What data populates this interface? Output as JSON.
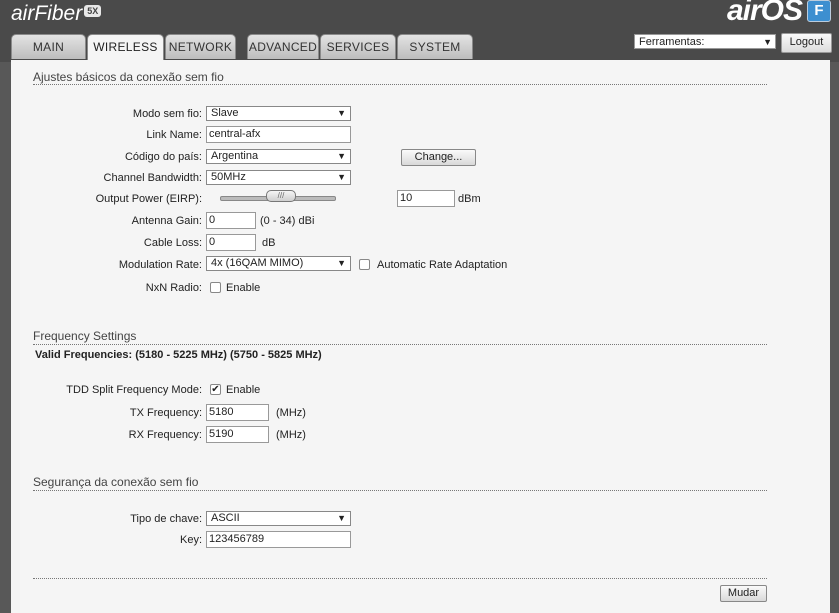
{
  "header": {
    "brand": "airFiber",
    "brand_badge": "5X",
    "product": "airOS",
    "product_badge": "F",
    "tools_select": "Ferramentas:",
    "logout_label": "Logout"
  },
  "tabs": [
    {
      "label": "MAIN",
      "active": false
    },
    {
      "label": "WIRELESS",
      "active": true
    },
    {
      "label": "NETWORK",
      "active": false
    },
    {
      "label": "ADVANCED",
      "active": false
    },
    {
      "label": "SERVICES",
      "active": false
    },
    {
      "label": "SYSTEM",
      "active": false
    }
  ],
  "basic": {
    "title": "Ajustes básicos da conexão sem fio",
    "wireless_mode_label": "Modo sem fio:",
    "wireless_mode_value": "Slave",
    "link_name_label": "Link Name:",
    "link_name_value": "central-afx",
    "country_label": "Código do país:",
    "country_value": "Argentina",
    "change_button": "Change...",
    "bandwidth_label": "Channel Bandwidth:",
    "bandwidth_value": "50MHz",
    "power_label": "Output Power (EIRP):",
    "power_value": "10",
    "power_unit": "dBm",
    "antenna_gain_label": "Antenna Gain:",
    "antenna_gain_value": "0",
    "antenna_gain_range": "(0 - 34) dBi",
    "cable_loss_label": "Cable Loss:",
    "cable_loss_value": "0",
    "cable_loss_unit": "dB",
    "modulation_label": "Modulation Rate:",
    "modulation_value": "4x (16QAM MIMO)",
    "auto_rate_label": "Automatic Rate Adaptation",
    "auto_rate_checked": false,
    "nxn_label": "NxN Radio:",
    "nxn_enable_label": "Enable",
    "nxn_checked": false
  },
  "frequency": {
    "title": "Frequency Settings",
    "valid_frequencies": "Valid Frequencies: (5180 - 5225 MHz) (5750 - 5825 MHz)",
    "tdd_label": "TDD Split Frequency Mode:",
    "tdd_enable_label": "Enable",
    "tdd_checked": true,
    "tx_label": "TX Frequency:",
    "tx_value": "5180",
    "tx_unit": "(MHz)",
    "rx_label": "RX Frequency:",
    "rx_value": "5190",
    "rx_unit": "(MHz)"
  },
  "security": {
    "title": "Segurança da conexão sem fio",
    "key_type_label": "Tipo de chave:",
    "key_type_value": "ASCII",
    "key_label": "Key:",
    "key_value": "123456789"
  },
  "footer": {
    "apply_button": "Mudar"
  }
}
